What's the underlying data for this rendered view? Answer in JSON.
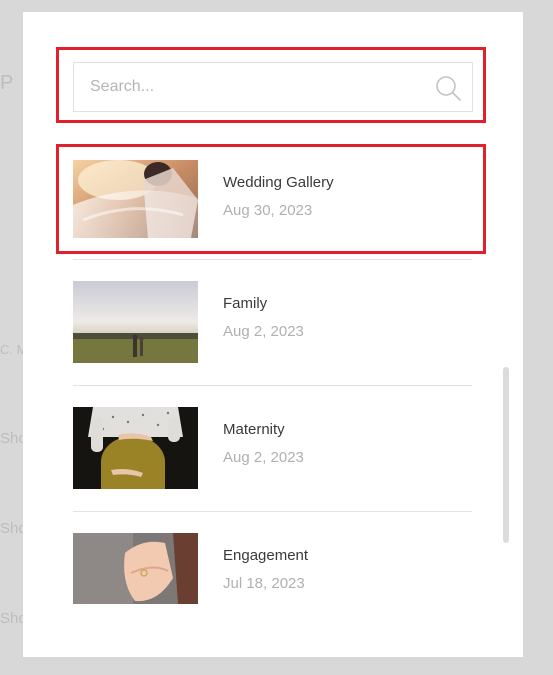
{
  "background_fragments": [
    "P F",
    "C. M",
    "Sho",
    "Sho",
    "Sho"
  ],
  "search": {
    "placeholder": "Search..."
  },
  "posts": [
    {
      "title": "Wedding Gallery",
      "date": "Aug 30, 2023"
    },
    {
      "title": "Family",
      "date": "Aug 2, 2023"
    },
    {
      "title": "Maternity",
      "date": "Aug 2, 2023"
    },
    {
      "title": "Engagement",
      "date": "Jul 18, 2023"
    }
  ],
  "colors": {
    "highlight": "#e0202a",
    "title": "#3a3a3a",
    "date": "#b0b0b0"
  }
}
